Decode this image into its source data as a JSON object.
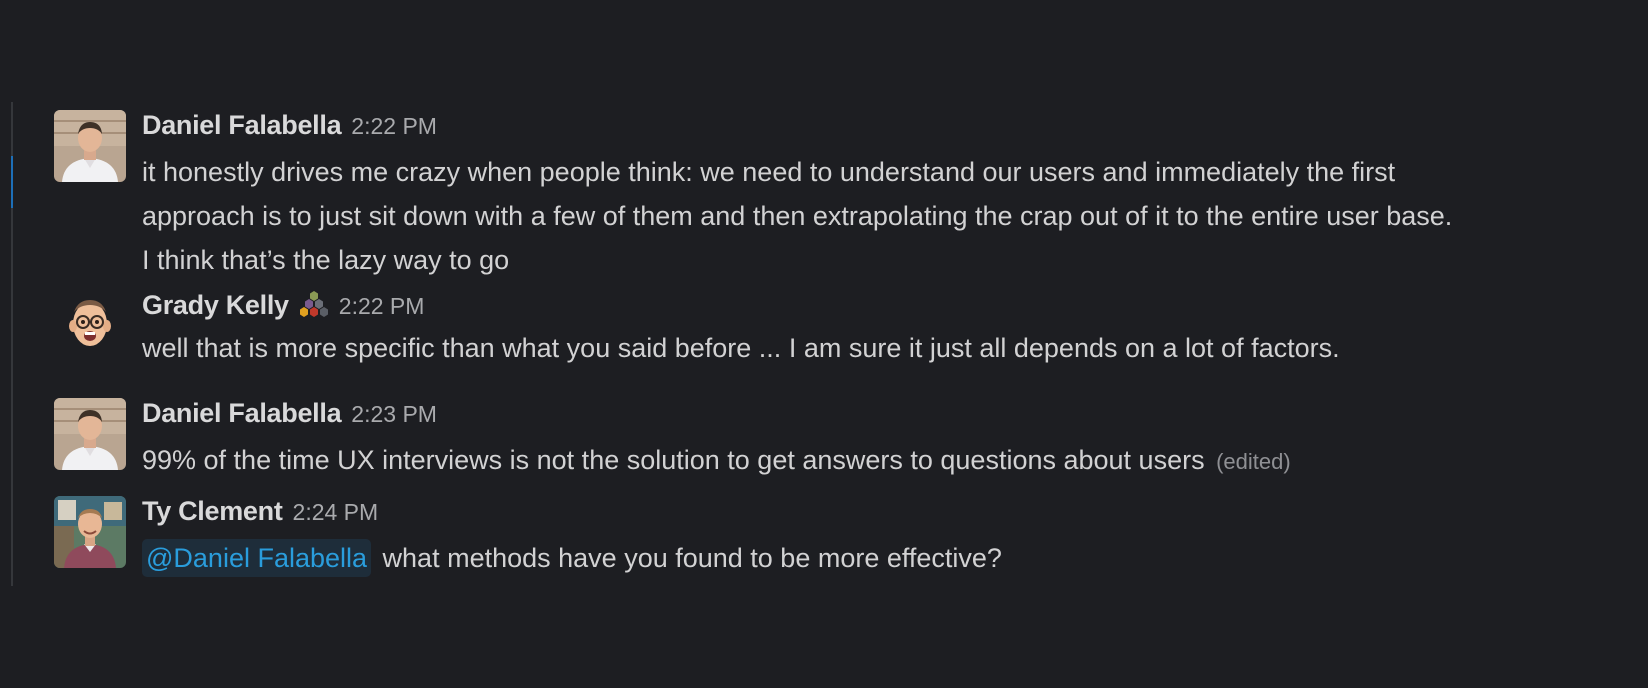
{
  "messages": [
    {
      "author": "Daniel Falabella",
      "time": "2:22 PM",
      "avatar": "daniel-photo",
      "lines": [
        "it honestly drives me crazy when people think: we need to understand our users and immediately the first",
        "approach is to just sit down with a few of them and then extrapolating the crap out of it to the entire user base.",
        "I think that’s the lazy way to go"
      ]
    },
    {
      "author": "Grady Kelly",
      "time": "2:22 PM",
      "avatar": "memoji-face",
      "badge_icon": "hexagon-cluster-icon",
      "lines": [
        "well that is more specific than what you said before ... I am sure it just all depends on a lot of factors."
      ]
    },
    {
      "author": "Daniel Falabella",
      "time": "2:23 PM",
      "avatar": "daniel-photo",
      "text": "99% of the time UX interviews is not the solution to get answers to questions about users",
      "edited": "(edited)"
    },
    {
      "author": "Ty Clement",
      "time": "2:24 PM",
      "avatar": "ty-photo",
      "mention": "@Daniel Falabella",
      "text": "what methods have you found to be more effective?"
    }
  ],
  "colors": {
    "background": "#1d1e22",
    "mention_text": "#2a9ddc",
    "mention_bg": "#1e2d3a",
    "thread_accent": "#1d6fb8"
  }
}
